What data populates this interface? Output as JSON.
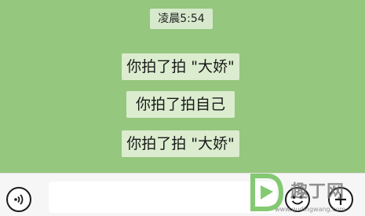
{
  "chat": {
    "timestamp": "凌晨5:54",
    "messages": [
      "你拍了拍 \"大娇\"",
      "你拍了拍自己",
      "你拍了拍 \"大娇\""
    ]
  },
  "input_bar": {
    "voice_icon": "voice-wave-icon",
    "emoji_icon": "smiley-icon",
    "plus_icon": "plus-icon",
    "input_value": "",
    "input_placeholder": ""
  },
  "watermark": {
    "text": "趣丁网",
    "url": "www.qudingwang.com"
  },
  "colors": {
    "chat_background": "#95c77e",
    "message_bubble": "#dbeccf",
    "input_bar": "#f6f6f6",
    "watermark_green": "#6fc15a"
  }
}
